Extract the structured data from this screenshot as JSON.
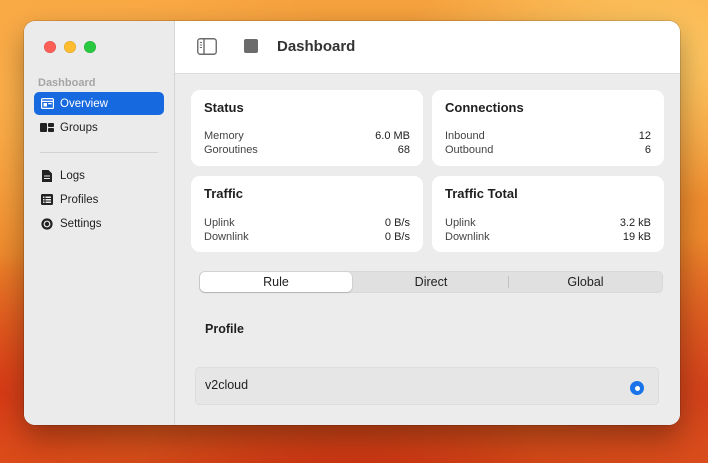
{
  "window": {
    "title": "Dashboard"
  },
  "sidebar": {
    "section_header": "Dashboard",
    "items": [
      {
        "label": "Overview",
        "icon": "overview-icon",
        "active": true
      },
      {
        "label": "Groups",
        "icon": "groups-icon",
        "active": false
      },
      {
        "label": "Logs",
        "icon": "document-icon",
        "active": false
      },
      {
        "label": "Profiles",
        "icon": "list-icon",
        "active": false
      },
      {
        "label": "Settings",
        "icon": "gear-icon",
        "active": false
      }
    ]
  },
  "toolbar": {
    "title": "Dashboard",
    "sidebar_icon": "sidebar-toggle-icon",
    "stop_icon": "stop-icon"
  },
  "cards": {
    "status": {
      "title": "Status",
      "rows": [
        {
          "label": "Memory",
          "value": "6.0 MB"
        },
        {
          "label": "Goroutines",
          "value": "68"
        }
      ]
    },
    "connections": {
      "title": "Connections",
      "rows": [
        {
          "label": "Inbound",
          "value": "12"
        },
        {
          "label": "Outbound",
          "value": "6"
        }
      ]
    },
    "traffic": {
      "title": "Traffic",
      "rows": [
        {
          "label": "Uplink",
          "value": "0 B/s"
        },
        {
          "label": "Downlink",
          "value": "0 B/s"
        }
      ]
    },
    "traffic_total": {
      "title": "Traffic Total",
      "rows": [
        {
          "label": "Uplink",
          "value": "3.2 kB"
        },
        {
          "label": "Downlink",
          "value": "19 kB"
        }
      ]
    }
  },
  "mode": {
    "options": [
      "Rule",
      "Direct",
      "Global"
    ],
    "selected": "Rule"
  },
  "profile": {
    "heading": "Profile",
    "items": [
      {
        "name": "v2cloud",
        "selected": true
      }
    ]
  },
  "colors": {
    "accent": "#1769e0",
    "radio": "#1a73e8"
  }
}
